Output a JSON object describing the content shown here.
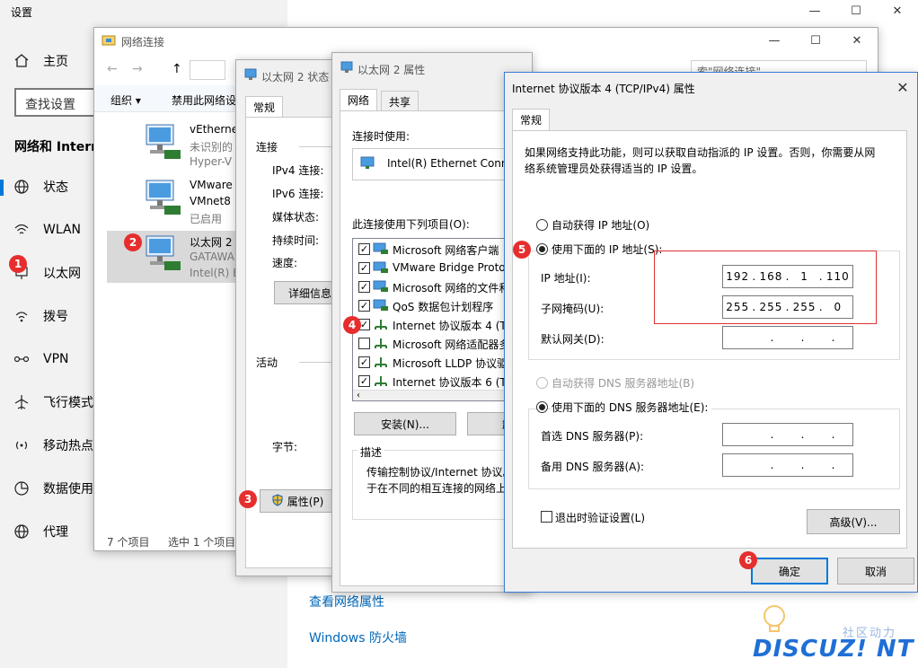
{
  "settings": {
    "title": "设置",
    "home": "主页",
    "search_placeholder": "查找设置",
    "section": "网络和 Intern",
    "nav": [
      {
        "label": "状态",
        "icon": "globe-icon"
      },
      {
        "label": "WLAN",
        "icon": "wifi-icon"
      },
      {
        "label": "以太网",
        "icon": "ethernet-icon"
      },
      {
        "label": "拨号",
        "icon": "dialup-icon"
      },
      {
        "label": "VPN",
        "icon": "vpn-icon"
      },
      {
        "label": "飞行模式",
        "icon": "airplane-icon"
      },
      {
        "label": "移动热点",
        "icon": "hotspot-icon"
      },
      {
        "label": "数据使用",
        "icon": "data-usage-icon"
      },
      {
        "label": "代理",
        "icon": "proxy-icon"
      }
    ],
    "links": [
      "查看网络属性",
      "Windows 防火墙"
    ],
    "caption": {
      "minimize": "—",
      "maximize": "☐",
      "close": "✕"
    }
  },
  "netconn": {
    "title": "网络连接",
    "search_placeholder": "索\"网络连接\"",
    "organize": "组织 ▾",
    "disable": "禁用此网络设",
    "adapters": [
      {
        "l1": "vEthernet",
        "l2": "未识别的",
        "l3": "Hyper-V"
      },
      {
        "l1": "VMware",
        "l2": "VMnet8",
        "l3": "已启用"
      },
      {
        "l1": "以太网 2",
        "l2": "GATAWA",
        "l3": "Intel(R) E"
      }
    ],
    "count": "7 个项目",
    "selected": "选中 1 个项目"
  },
  "status": {
    "title": "以太网 2 状态",
    "tab": "常规",
    "connection": "连接",
    "rows": [
      "IPv4 连接:",
      "IPv6 连接:",
      "媒体状态:",
      "持续时间:",
      "速度:"
    ],
    "details": "详细信息",
    "activity": "活动",
    "bytes": "字节:",
    "properties": "属性(P)"
  },
  "props": {
    "title": "以太网 2 属性",
    "tabs": [
      "网络",
      "共享"
    ],
    "connect_using": "连接时使用:",
    "adapter": "Intel(R) Ethernet Conne",
    "items_label": "此连接使用下列项目(O):",
    "items": [
      {
        "label": "Microsoft 网络客户端",
        "checked": "✓"
      },
      {
        "label": "VMware Bridge Proto",
        "checked": "✓"
      },
      {
        "label": "Microsoft 网络的文件和",
        "checked": "✓"
      },
      {
        "label": "QoS 数据包计划程序",
        "checked": "✓"
      },
      {
        "label": "Internet 协议版本 4 (TC",
        "checked": "✓"
      },
      {
        "label": "Microsoft 网络适配器多",
        "checked": ""
      },
      {
        "label": "Microsoft LLDP 协议驱",
        "checked": "✓"
      },
      {
        "label": "Internet 协议版本 6 (TC",
        "checked": "✓"
      }
    ],
    "install": "安装(N)...",
    "uninstall": "卸",
    "desc_title": "描述",
    "desc": "传输控制协议/Internet 协议。\n于在不同的相互连接的网络上"
  },
  "ipv4": {
    "title": "Internet 协议版本 4 (TCP/IPv4) 属性",
    "tab": "常规",
    "intro": "如果网络支持此功能，则可以获取自动指派的 IP 设置。否则，你需要从网\n络系统管理员处获得适当的 IP 设置。",
    "auto_ip": "自动获得 IP 地址(O)",
    "manual_ip": "使用下面的 IP 地址(S):",
    "ip_label": "IP 地址(I):",
    "ip": [
      "192",
      "168",
      "1",
      "110"
    ],
    "mask_label": "子网掩码(U):",
    "mask": [
      "255",
      "255",
      "255",
      "0"
    ],
    "gateway_label": "默认网关(D):",
    "auto_dns": "自动获得 DNS 服务器地址(B)",
    "manual_dns": "使用下面的 DNS 服务器地址(E):",
    "dns1_label": "首选 DNS 服务器(P):",
    "dns2_label": "备用 DNS 服务器(A):",
    "validate": "退出时验证设置(L)",
    "advanced": "高级(V)...",
    "ok": "确定",
    "cancel": "取消",
    "dot": "."
  },
  "badges": [
    "1",
    "2",
    "3",
    "4",
    "5",
    "6"
  ],
  "watermark": {
    "cn": "社区动力",
    "en": "DISCUZ! NT"
  },
  "colors": {
    "accent": "#0078d7",
    "badge": "#e62e2e",
    "link": "#0067b8",
    "watermark": "#1f6fd6"
  }
}
